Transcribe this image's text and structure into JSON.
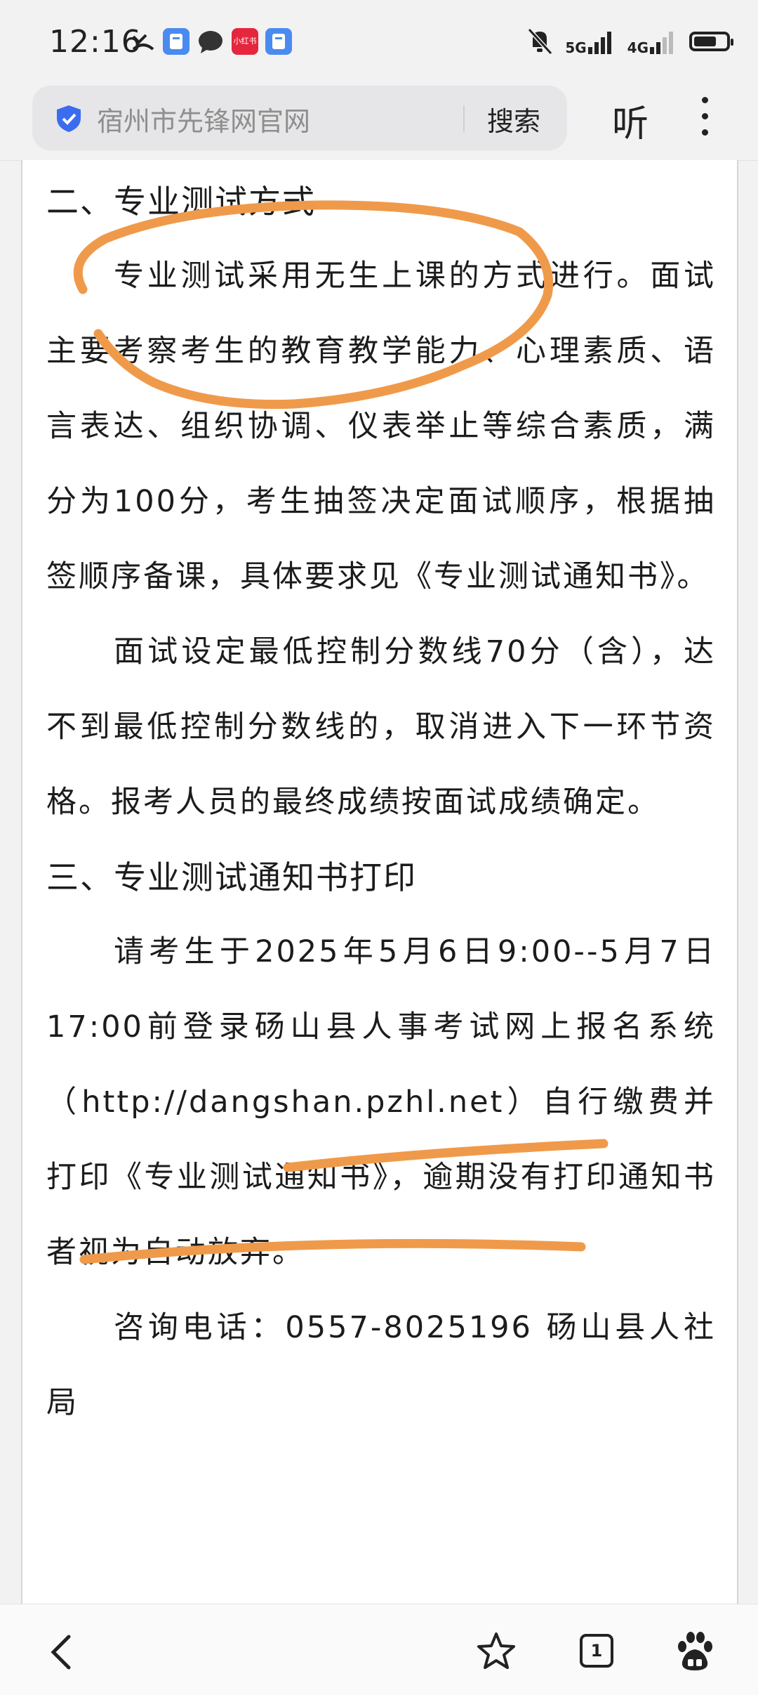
{
  "status_bar": {
    "time": "12:16",
    "network_1": "5G",
    "network_2": "4G",
    "app_badge": "小红书"
  },
  "search_bar": {
    "query": "宿州市先锋网官网",
    "search_button": "搜索",
    "listen_button": "听"
  },
  "article": {
    "section2_heading": "二、专业测试方式",
    "section2_para1": "专业测试采用无生上课的方式进行。面试主要考察考生的教育教学能力、心理素质、语言表达、组织协调、仪表举止等综合素质，满分为100分，考生抽签决定面试顺序，根据抽签顺序备课，具体要求见《专业测试通知书》。",
    "section2_para2": "面试设定最低控制分数线70分（含），达不到最低控制分数线的，取消进入下一环节资格。报考人员的最终成绩按面试成绩确定。",
    "section3_heading": "三、专业测试通知书打印",
    "section3_para1": "请考生于2025年5月6日9:00--5月7日17:00前登录砀山县人事考试网上报名系统（http://dangshan.pzhl.net）自行缴费并打印《专业测试通知书》，逾期没有打印通知书者视为自动放弃。",
    "section3_para2": "咨询电话：0557-8025196  砀山县人社局"
  },
  "bottom_nav": {
    "tab_count": "1"
  },
  "colors": {
    "annotation_orange": "#ef9a4a",
    "shield_blue": "#3b6cf0"
  },
  "icons": [
    "back-icon",
    "star-icon",
    "tabs-icon",
    "baidu-paw-icon",
    "shield-icon",
    "more-icon"
  ]
}
